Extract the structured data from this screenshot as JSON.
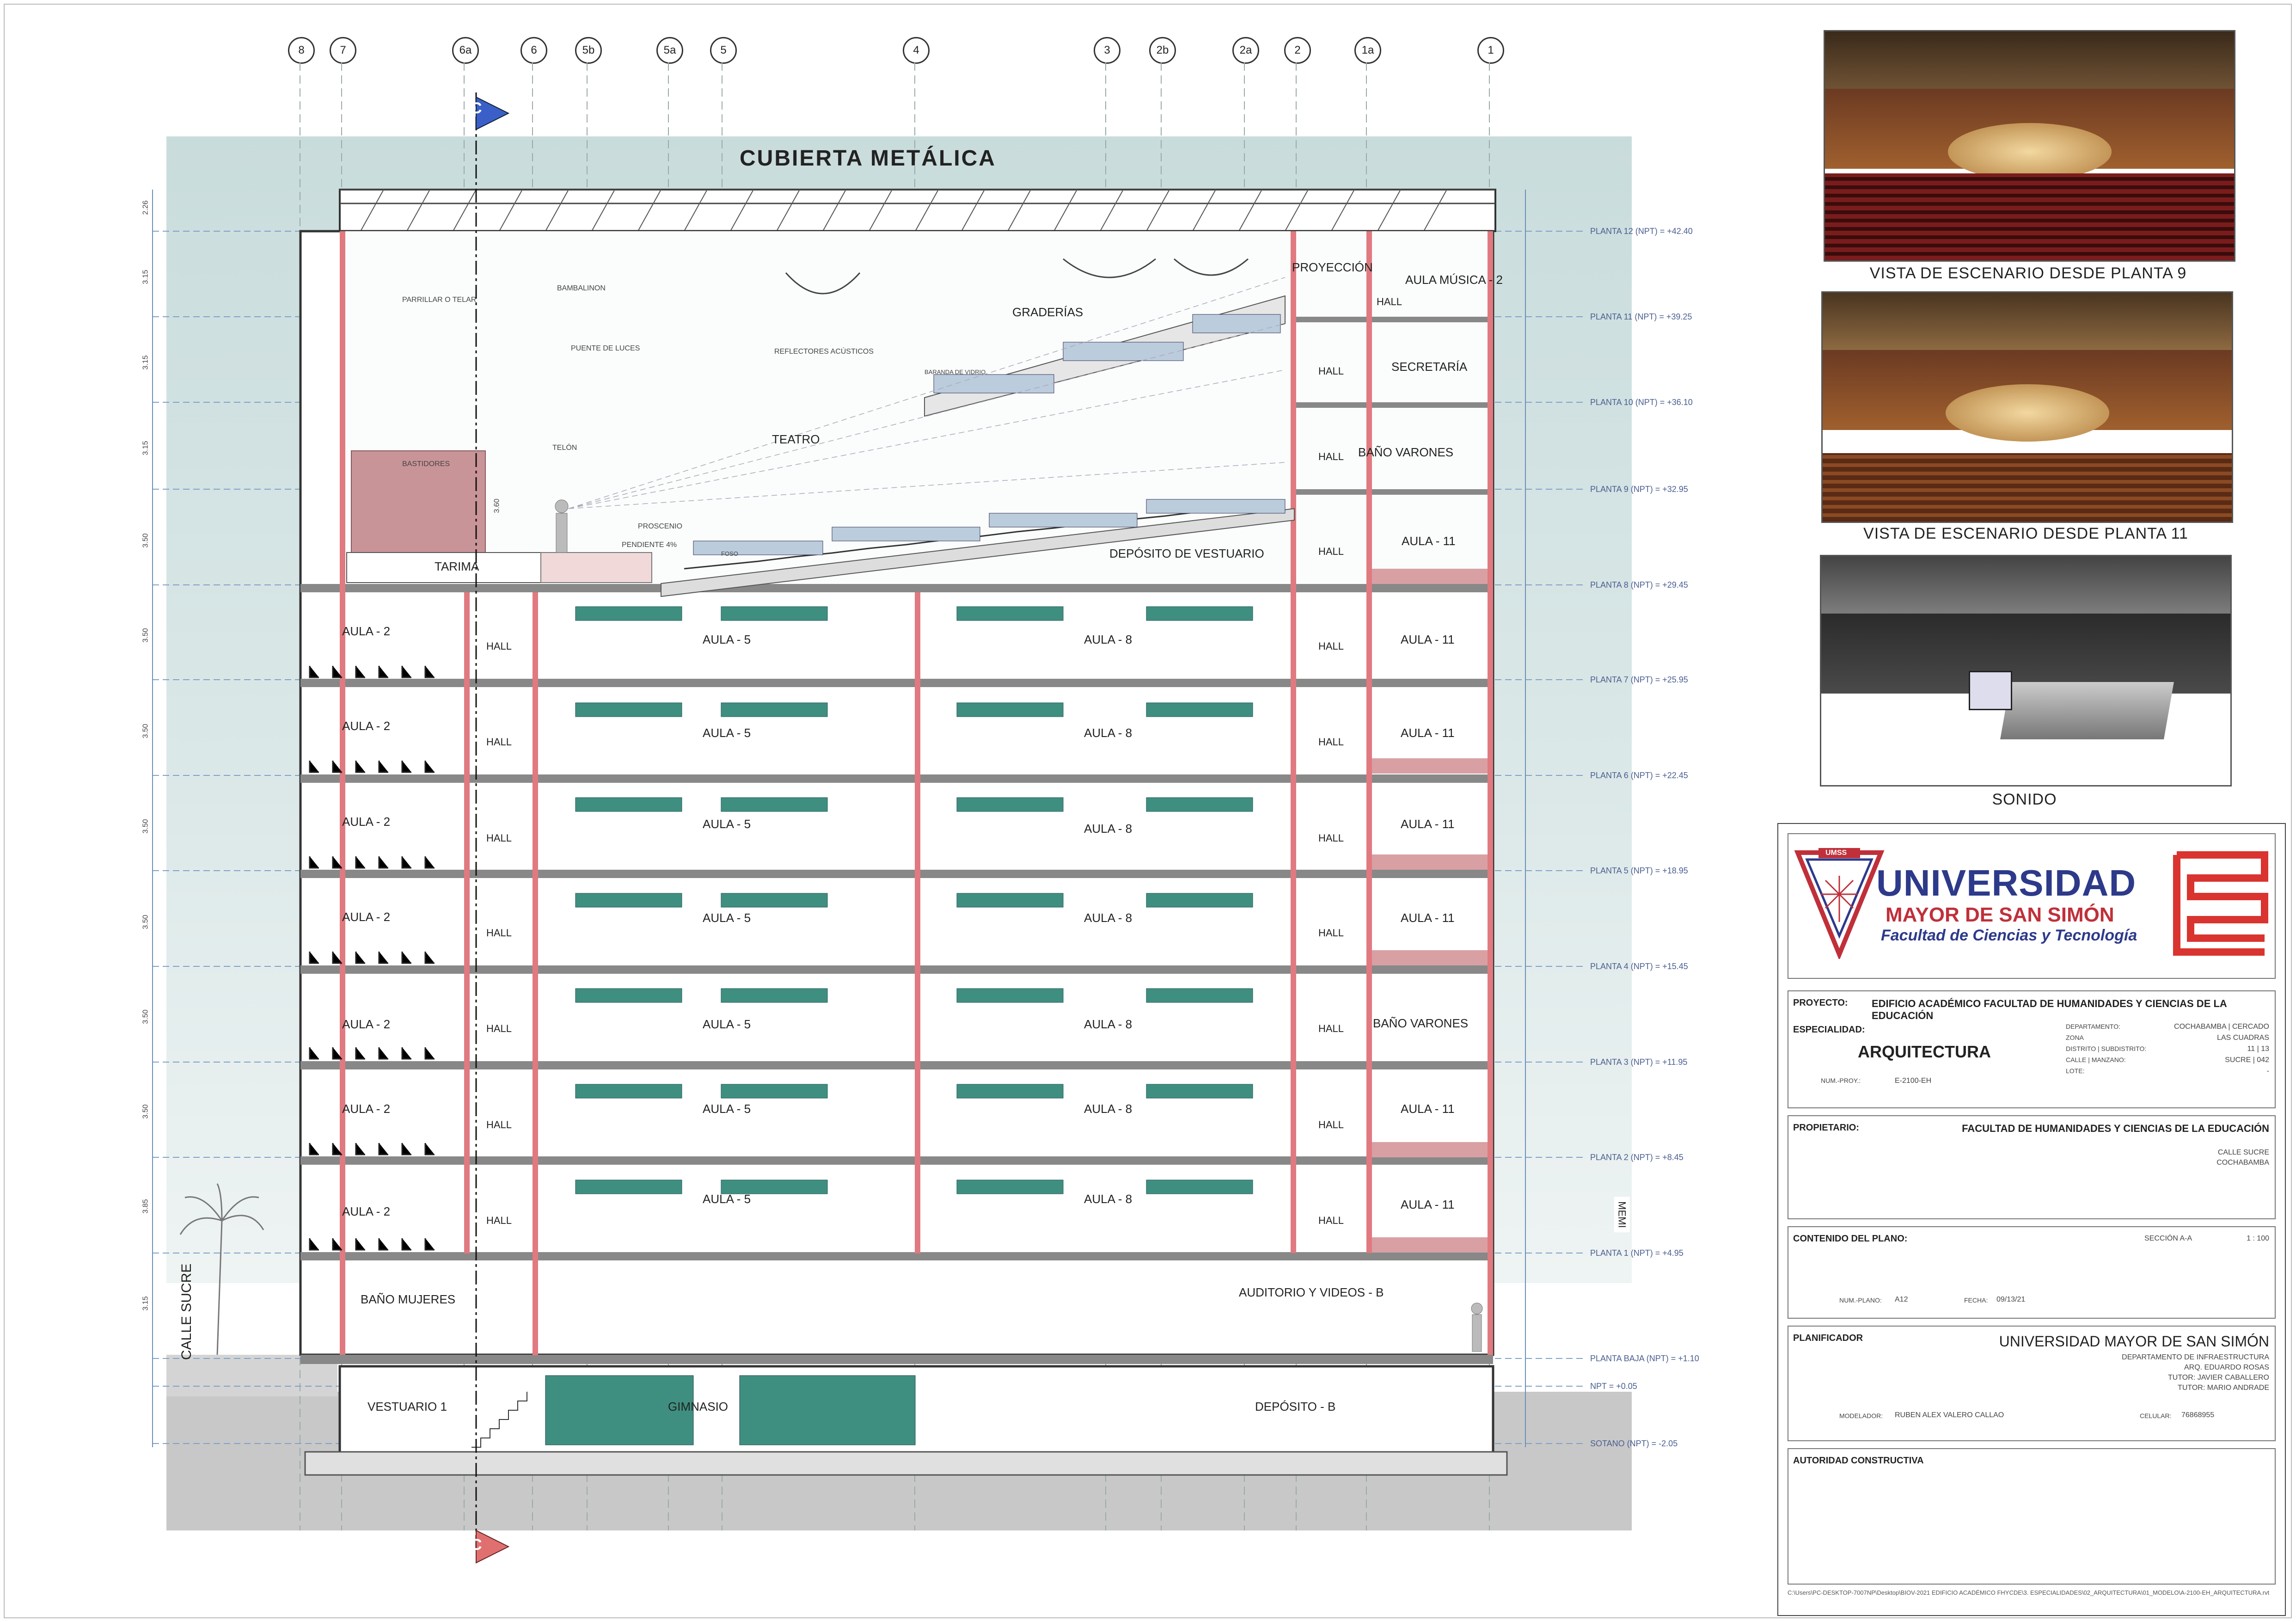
{
  "drawing": {
    "roof_label": "CUBIERTA METÁLICA",
    "section_marker": "C",
    "street_label": "CALLE SUCRE",
    "side_label": "MEMI",
    "grid_axes": [
      "8",
      "7",
      "6a",
      "6",
      "5b",
      "5a",
      "5",
      "4",
      "3",
      "2b",
      "2a",
      "2",
      "1a",
      "1"
    ],
    "levels": [
      "PLANTA 12 (NPT) = +42.40",
      "PLANTA 11 (NPT) = +39.25",
      "PLANTA 10 (NPT) = +36.10",
      "PLANTA 9 (NPT) = +32.95",
      "PLANTA 8 (NPT) = +29.45",
      "PLANTA 7 (NPT) = +25.95",
      "PLANTA 6 (NPT) = +22.45",
      "PLANTA 5 (NPT) = +18.95",
      "PLANTA 4 (NPT) = +15.45",
      "PLANTA 3 (NPT) = +11.95",
      "PLANTA 2 (NPT) = +8.45",
      "PLANTA 1 (NPT) = +4.95",
      "PLANTA BAJA (NPT) = +1.10",
      "NPT = +0.05",
      "SOTANO (NPT) = -2.05"
    ],
    "heights": [
      "2.26",
      "3.15",
      "3.15",
      "3.15",
      "3.50",
      "3.50",
      "3.50",
      "3.50",
      "3.50",
      "3.50",
      "3.50",
      "3.85",
      "3.15"
    ],
    "theatre": {
      "parrillar": "PARRILLAR O TELAR",
      "bambalinon": "BAMBALINON",
      "puente": "PUENTE DE LUCES",
      "reflectores": "REFLECTORES ACÚSTICOS",
      "baranda": "BARANDA DE VIDRIO",
      "graderias": "GRADERÍAS",
      "teatro": "TEATRO",
      "telon": "TELÓN",
      "bastidores": "BASTIDORES",
      "proscenio": "PROSCENIO",
      "pendiente": "PENDIENTE 4%",
      "foso": "FOSO",
      "tarima": "TARIMA",
      "deposito": "DEPÓSITO DE VESTUARIO",
      "proyeccion": "PROYECCIÓN",
      "aula_musica": "AULA MÚSICA - 2",
      "hall": "HALL",
      "secretaria": "SECRETARÍA",
      "bano_varones": "BAÑO VARONES",
      "aula_11": "AULA - 11",
      "height_note": "3.60"
    },
    "typical": {
      "aula_2": "AULA - 2",
      "hall": "HALL",
      "aula_5": "AULA - 5",
      "aula_8": "AULA - 8",
      "aula_11": "AULA - 11",
      "bano_varones": "BAÑO VARONES"
    },
    "ground": {
      "bano_mujeres": "BAÑO MUJERES",
      "auditorio": "AUDITORIO Y VIDEOS - B"
    },
    "basement": {
      "vestuario": "VESTUARIO 1",
      "gimnasio": "GIMNASIO",
      "deposito": "DEPÓSITO - B"
    }
  },
  "views": [
    {
      "caption": "VISTA DE ESCENARIO DESDE PLANTA 9"
    },
    {
      "caption": "VISTA DE ESCENARIO DESDE PLANTA 11"
    },
    {
      "caption": "SONIDO"
    }
  ],
  "title_block": {
    "logo_badge": "UMSS",
    "university": "UNIVERSIDAD",
    "university_line2": "MAYOR DE SAN SIMÓN",
    "faculty": "Facultad de Ciencias y Tecnología",
    "proyecto_label": "PROYECTO:",
    "proyecto_value": "EDIFICIO ACADÉMICO FACULTAD DE HUMANIDADES Y CIENCIAS DE LA EDUCACIÓN",
    "especialidad_label": "ESPECIALIDAD:",
    "especialidad_value": "ARQUITECTURA",
    "num_proy_label": "NUM.-PROY.:",
    "num_proy_value": "E-2100-EH",
    "departamento_label": "DEPARTAMENTO:",
    "departamento_value": "COCHABAMBA | CERCADO",
    "zona_label": "ZONA",
    "zona_value": "LAS CUADRAS",
    "distrito_label": "DISTRITO | SUBDISTRITO:",
    "distrito_value": "11 | 13",
    "calle_label": "CALLE | MANZANO:",
    "calle_value": "SUCRE | 042",
    "lote_label": "LOTE:",
    "lote_value": "-",
    "propietario_label": "PROPIETARIO:",
    "propietario_value": "FACULTAD DE HUMANIDADES Y CIENCIAS DE LA EDUCACIÓN",
    "propietario_addr1": "CALLE SUCRE",
    "propietario_addr2": "COCHABAMBA",
    "contenido_label": "CONTENIDO DEL PLANO:",
    "contenido_value": "SECCIÓN A-A",
    "escala": "1 : 100",
    "num_plano_label": "NUM.-PLANO:",
    "num_plano_value": "A12",
    "fecha_label": "FECHA:",
    "fecha_value": "09/13/21",
    "planificador_label": "PLANIFICADOR",
    "planificador_value": "UNIVERSIDAD MAYOR DE SAN SIMÓN",
    "planificador_1": "DEPARTAMENTO DE INFRAESTRUCTURA",
    "planificador_2": "ARQ. EDUARDO ROSAS",
    "planificador_3": "TUTOR: JAVIER CABALLERO",
    "planificador_4": "TUTOR: MARIO ANDRADE",
    "modelador_label": "MODELADOR:",
    "modelador_value": "RUBEN ALEX VALERO CALLAO",
    "celular_label": "CELULAR:",
    "celular_value": "76868955",
    "autoridad_label": "AUTORIDAD CONSTRUCTIVA",
    "file_path": "C:\\Users\\PC-DESKTOP-7007NP\\Desktop\\BIOV-2021 EDIFICIO ACADÉMICO FHYCDE\\3. ESPECIALIDADES\\02_ARQUITECTURA\\01_MODELO\\A-2100-EH_ARQUITECTURA.rvt"
  }
}
